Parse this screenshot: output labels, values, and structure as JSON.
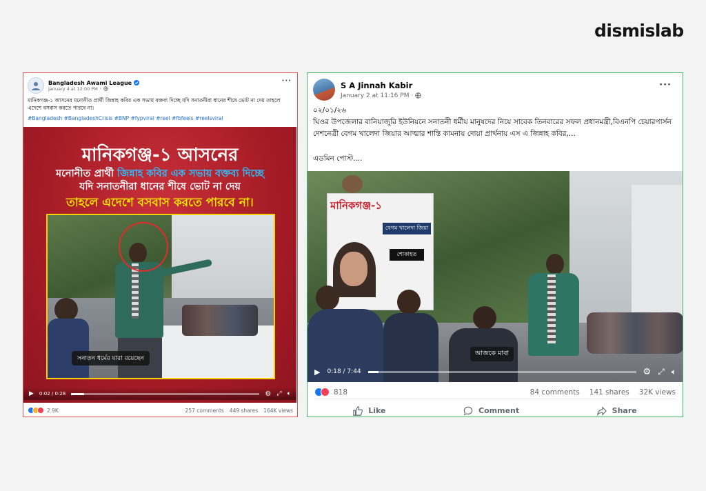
{
  "brand": "dismislab",
  "left_post": {
    "page_name": "Bangladesh Awami League",
    "timestamp": "January 4 at 12:00 PM",
    "body": "মানিকগঞ্জ-১ আসনের মনোনীত প্রার্থী জিন্নাহ কবির এক সভায় বক্তব্য দিচ্ছে যদি সনাতনীরা ধানের শীষে ভোট না দেয় তাহলে এদেশে বসবাস করতে পারবে না।",
    "hashtags": "#Bangladesh #BangladeshCrisis #BNP #fypviral #reel #fbfeels #reelsviral",
    "banner_line1": "মানিকগঞ্জ-১ আসনের",
    "banner_line2a": "মনোনীত প্রার্থী ",
    "banner_line2b": "জিন্নাহ কবির এক সভায় বক্তব্য দিচ্ছে",
    "banner_line3": "যদি সনাতনীরা ধানের শীষে ভোট না দেয়",
    "banner_line4": "তাহলে এদেশে বসবাস করতে পারবে না।",
    "video_caption": "সনাতন ধর্মের যারা রয়েছেন",
    "video_time": "0:02 / 0:28",
    "progress": 0.07,
    "reactions": "2.9K",
    "comments": "257 comments",
    "shares": "449 shares",
    "views": "164K views"
  },
  "right_post": {
    "author": "S A Jinnah Kabir",
    "timestamp": "January 2 at 11:16 PM",
    "date_line": "০২/০১/২৬",
    "body": "ঘিওর উপজেলার বানিয়াজুরি ইউনিয়নে সনাতনী ধর্মীয় মানুষদের নিয়ে সাবেক তিনবারের সফল প্রধানমন্ত্রী,বিএনপি চেয়ারপার্সন দেশনেত্রী বেগম খালেদা জিয়ার আত্মার শান্তি কামনায় দোয়া প্রার্থনায় এস এ জিন্নাহ কবির,...",
    "signature": "এডমিন পোস্ট....",
    "video_banner": "মানিকগঞ্জ-১",
    "video_sign": "বেগম খালেদা জিয়া",
    "video_sign2": "শোকাহত",
    "video_caption": "আজকে মাবা",
    "video_time": "0:18 / 7:44",
    "progress": 0.04,
    "reactions": "818",
    "comments": "84 comments",
    "shares": "141 shares",
    "views": "32K views",
    "like_label": "Like",
    "comment_label": "Comment",
    "share_label": "Share"
  },
  "colors": {
    "left_border": "#e05353",
    "right_border": "#46b46f",
    "banner_bg": "#b31f2a",
    "accent_yellow": "#ffe600",
    "accent_blue": "#2bc1ff",
    "fb_blue": "#1877f2"
  }
}
